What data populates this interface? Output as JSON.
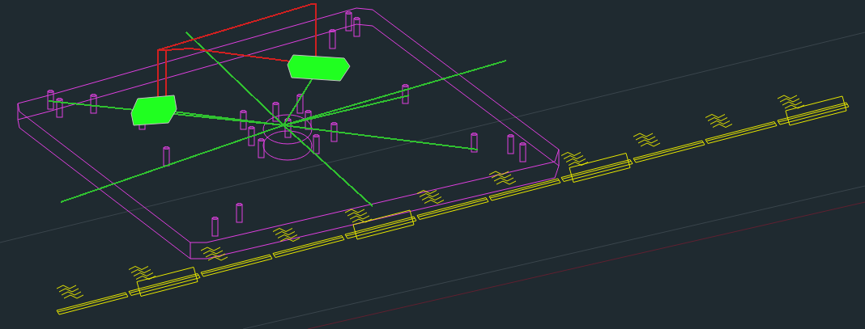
{
  "viewport": {
    "kind": "wireframe",
    "layers": [
      {
        "kind": "board",
        "color": "#e040e0"
      },
      {
        "kind": "ratsnest",
        "color": "#30c030"
      },
      {
        "kind": "guides",
        "color": "#d02020"
      },
      {
        "kind": "chips",
        "color": "#20ff20"
      },
      {
        "kind": "notes",
        "color": "#e8e800"
      }
    ]
  }
}
